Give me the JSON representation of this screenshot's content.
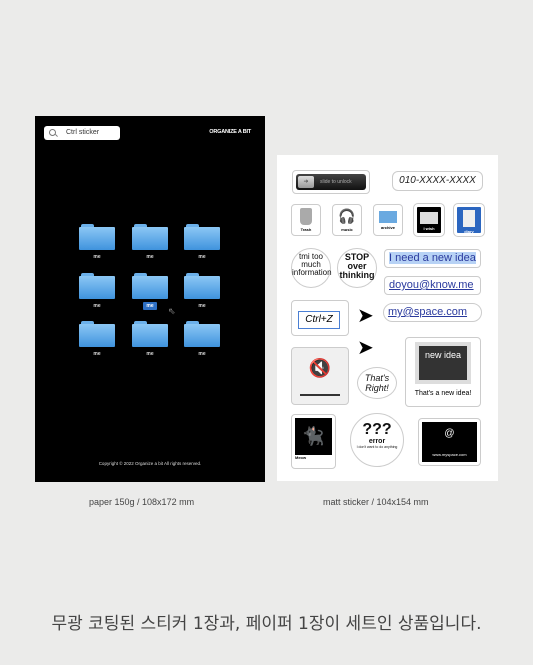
{
  "paper": {
    "search_text": "Ctrl sticker",
    "brand": "ORGANIZE A BIT",
    "folders": [
      {
        "label": "me",
        "selected": false
      },
      {
        "label": "me",
        "selected": false
      },
      {
        "label": "me",
        "selected": false
      },
      {
        "label": "me",
        "selected": false
      },
      {
        "label": "me",
        "selected": true
      },
      {
        "label": "me",
        "selected": false
      },
      {
        "label": "me",
        "selected": false
      },
      {
        "label": "me",
        "selected": false
      },
      {
        "label": "me",
        "selected": false
      }
    ],
    "copyright": "Copyright © 2022 Organize a bit All rights reserved."
  },
  "sheet": {
    "slide_label": "slide to unlock",
    "phone": "010-XXXX-XXXX",
    "icons": [
      "Trash",
      "music",
      "archive",
      "I wish",
      "diary"
    ],
    "tmi": "tmi too much information",
    "stop": "STOP over thinking",
    "idea": "I need a new idea",
    "email1": "doyou@know.me",
    "email2": "my@space.com",
    "ctrlz": "Ctrl+Z",
    "thats_right": "That's Right!",
    "new_idea_screen": "new idea",
    "new_idea_caption": "That's a new idea!",
    "cat_label": "Meow",
    "error_q": "???",
    "error_title": "error",
    "error_sub": "I don't want to do anything",
    "myspace_url": "www.myspace.com"
  },
  "captions": {
    "paper": "paper 150g  /  108x172 mm",
    "sticker": "matt sticker  /  104x154 mm"
  },
  "tagline": "무광 코팅된 스티커 1장과, 페이퍼 1장이 세트인 상품입니다.",
  "colors": {
    "background": "#ebebea",
    "folder_blue": "#5aa8ec",
    "selection": "#2d6fc4",
    "link": "#2a3a9e"
  }
}
